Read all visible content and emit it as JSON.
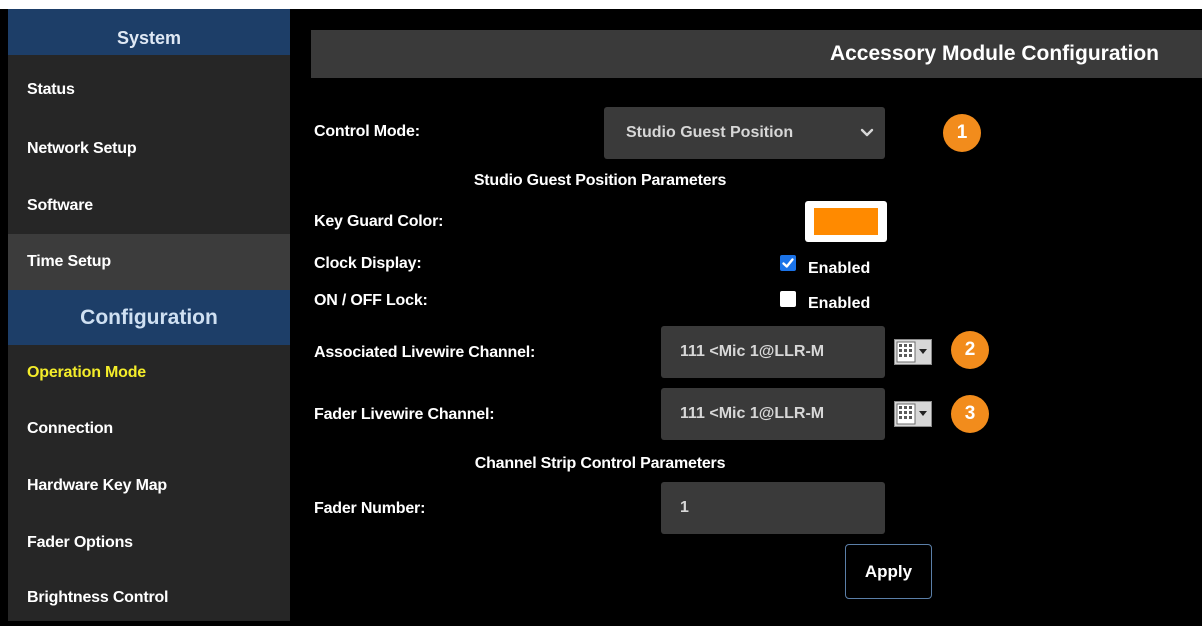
{
  "sidebar": {
    "system_heading": "System",
    "system_items": [
      {
        "label": "Status"
      },
      {
        "label": "Network Setup"
      },
      {
        "label": "Software"
      },
      {
        "label": "Time Setup"
      }
    ],
    "configuration_heading": "Configuration",
    "configuration_items": [
      {
        "label": "Operation Mode"
      },
      {
        "label": "Connection"
      },
      {
        "label": "Hardware Key Map"
      },
      {
        "label": "Fader Options"
      },
      {
        "label": "Brightness Control"
      }
    ]
  },
  "main": {
    "title": "Accessory Module Configuration",
    "control_mode": {
      "label": "Control Mode:",
      "value": "Studio Guest Position"
    },
    "guest_section_heading": "Studio Guest Position Parameters",
    "key_guard_color": {
      "label": "Key Guard Color:",
      "color": "#ff8a00"
    },
    "clock_display": {
      "label": "Clock Display:",
      "option": "Enabled",
      "checked": true
    },
    "on_off_lock": {
      "label": "ON / OFF Lock:",
      "option": "Enabled",
      "checked": false
    },
    "associated_channel": {
      "label": "Associated Livewire Channel:",
      "value": "111 <Mic 1@LLR-M"
    },
    "fader_channel": {
      "label": "Fader Livewire Channel:",
      "value": "111 <Mic 1@LLR-M"
    },
    "channel_strip_heading": "Channel Strip Control Parameters",
    "fader_number": {
      "label": "Fader Number:",
      "value": "1"
    },
    "apply_label": "Apply"
  },
  "badges": [
    "1",
    "2",
    "3"
  ],
  "colors": {
    "sidebar_bg": "#262626",
    "section_header": "#1d3e68",
    "active_nav_text": "#f4ed2a",
    "badge": "#f28c1c",
    "checkbox": "#1b73e8"
  }
}
